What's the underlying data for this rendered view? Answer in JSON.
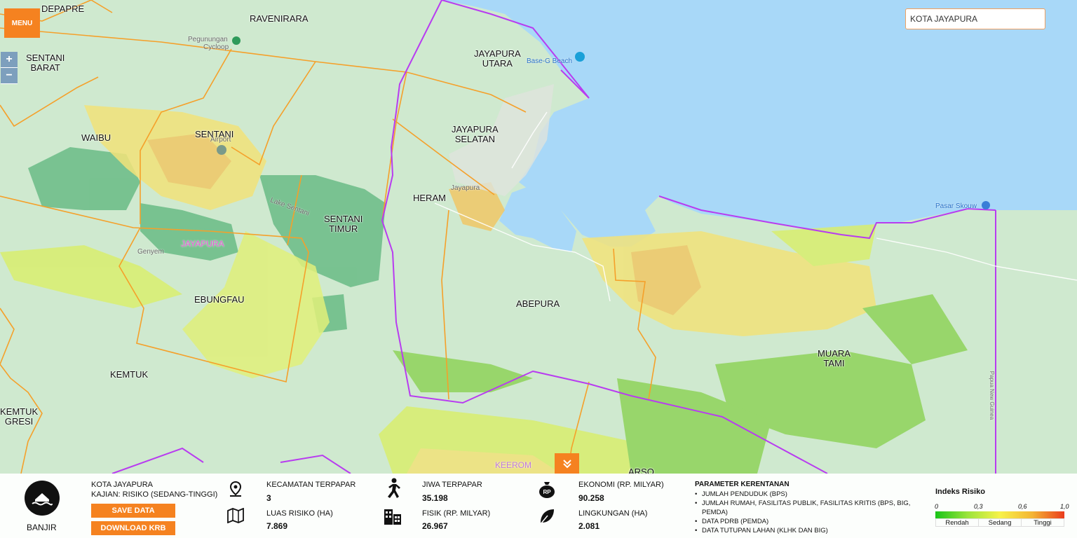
{
  "menu": {
    "label": "MENU"
  },
  "zoom": {
    "in_label": "+",
    "out_label": "−"
  },
  "search": {
    "value": "KOTA JAYAPURA"
  },
  "map_labels": {
    "depapre": "DEPAPRE",
    "ravenirara": "RAVENIRARA",
    "sentani_barat": "SENTANI\nBARAT",
    "jayapura_utara": "JAYAPURA\nUTARA",
    "waibu": "WAIBU",
    "sentani": "SENTANI",
    "jayapura_selatan": "JAYAPURA\nSELATAN",
    "heram": "HERAM",
    "sentani_timur": "SENTANI\nTIMUR",
    "ebungfau": "EBUNGFAU",
    "abepura": "ABEPURA",
    "muara_tami": "MUARA\nTAMI",
    "kemtuk": "KEMTUK",
    "kemtuk_gresi": "KEMTUK\nGRESI",
    "arso": "ARSO"
  },
  "pois": {
    "pegunungan": "Pegunungan",
    "cycloop": "Cycloop",
    "base_g": "Base-G Beach",
    "airport": "Airport",
    "jayapura_town": "Jayapura",
    "danau": "Lake Sentani",
    "jayapura_regency": "JAYAPURA",
    "genyem": "Genyem",
    "pasar_skouw": "Pasar Skouw",
    "keerom": "KEEROM",
    "border": "Papua New Guinea"
  },
  "colors": {
    "accent": "#f58220",
    "sea": "#a8d8f8",
    "land": "#cfe9cf",
    "boundary_district": "#f5a02a",
    "boundary_city": "#b83cf0"
  },
  "panel": {
    "hazard": {
      "label": "BANJIR",
      "icon": "flood-icon"
    },
    "location": "KOTA JAYAPURA",
    "kajian": "KAJIAN: RISIKO (SEDANG-TINGGI)",
    "save_label": "SAVE DATA",
    "download_label": "DOWNLOAD KRB",
    "stats": [
      {
        "label": "KECAMATAN TERPAPAR",
        "value": "3",
        "icon": "map-pin-icon"
      },
      {
        "label": "LUAS RISIKO (HA)",
        "value": "7.869",
        "icon": "map-icon"
      },
      {
        "label": "JIWA TERPAPAR",
        "value": "35.198",
        "icon": "person-running-icon"
      },
      {
        "label": "FISIK (RP. MILYAR)",
        "value": "26.967",
        "icon": "building-icon"
      },
      {
        "label": "EKONOMI (RP. MILYAR)",
        "value": "90.258",
        "icon": "money-bag-icon"
      },
      {
        "label": "LINGKUNGAN (HA)",
        "value": "2.081",
        "icon": "leaf-icon"
      }
    ],
    "parameters": {
      "title": "PARAMETER KERENTANAN",
      "items": [
        "JUMLAH PENDUDUK (BPS)",
        "JUMLAH RUMAH, FASILITAS PUBLIK, FASILITAS KRITIS (BPS, BIG, PEMDA)",
        "DATA PDRB (PEMDA)",
        "DATA TUTUPAN LAHAN (KLHK DAN BIG)"
      ]
    },
    "legend": {
      "title": "Indeks Risiko",
      "ticks": [
        "0",
        "0,3",
        "0,6",
        "1,0"
      ],
      "categories": [
        "Rendah",
        "Sedang",
        "Tinggi"
      ]
    }
  }
}
